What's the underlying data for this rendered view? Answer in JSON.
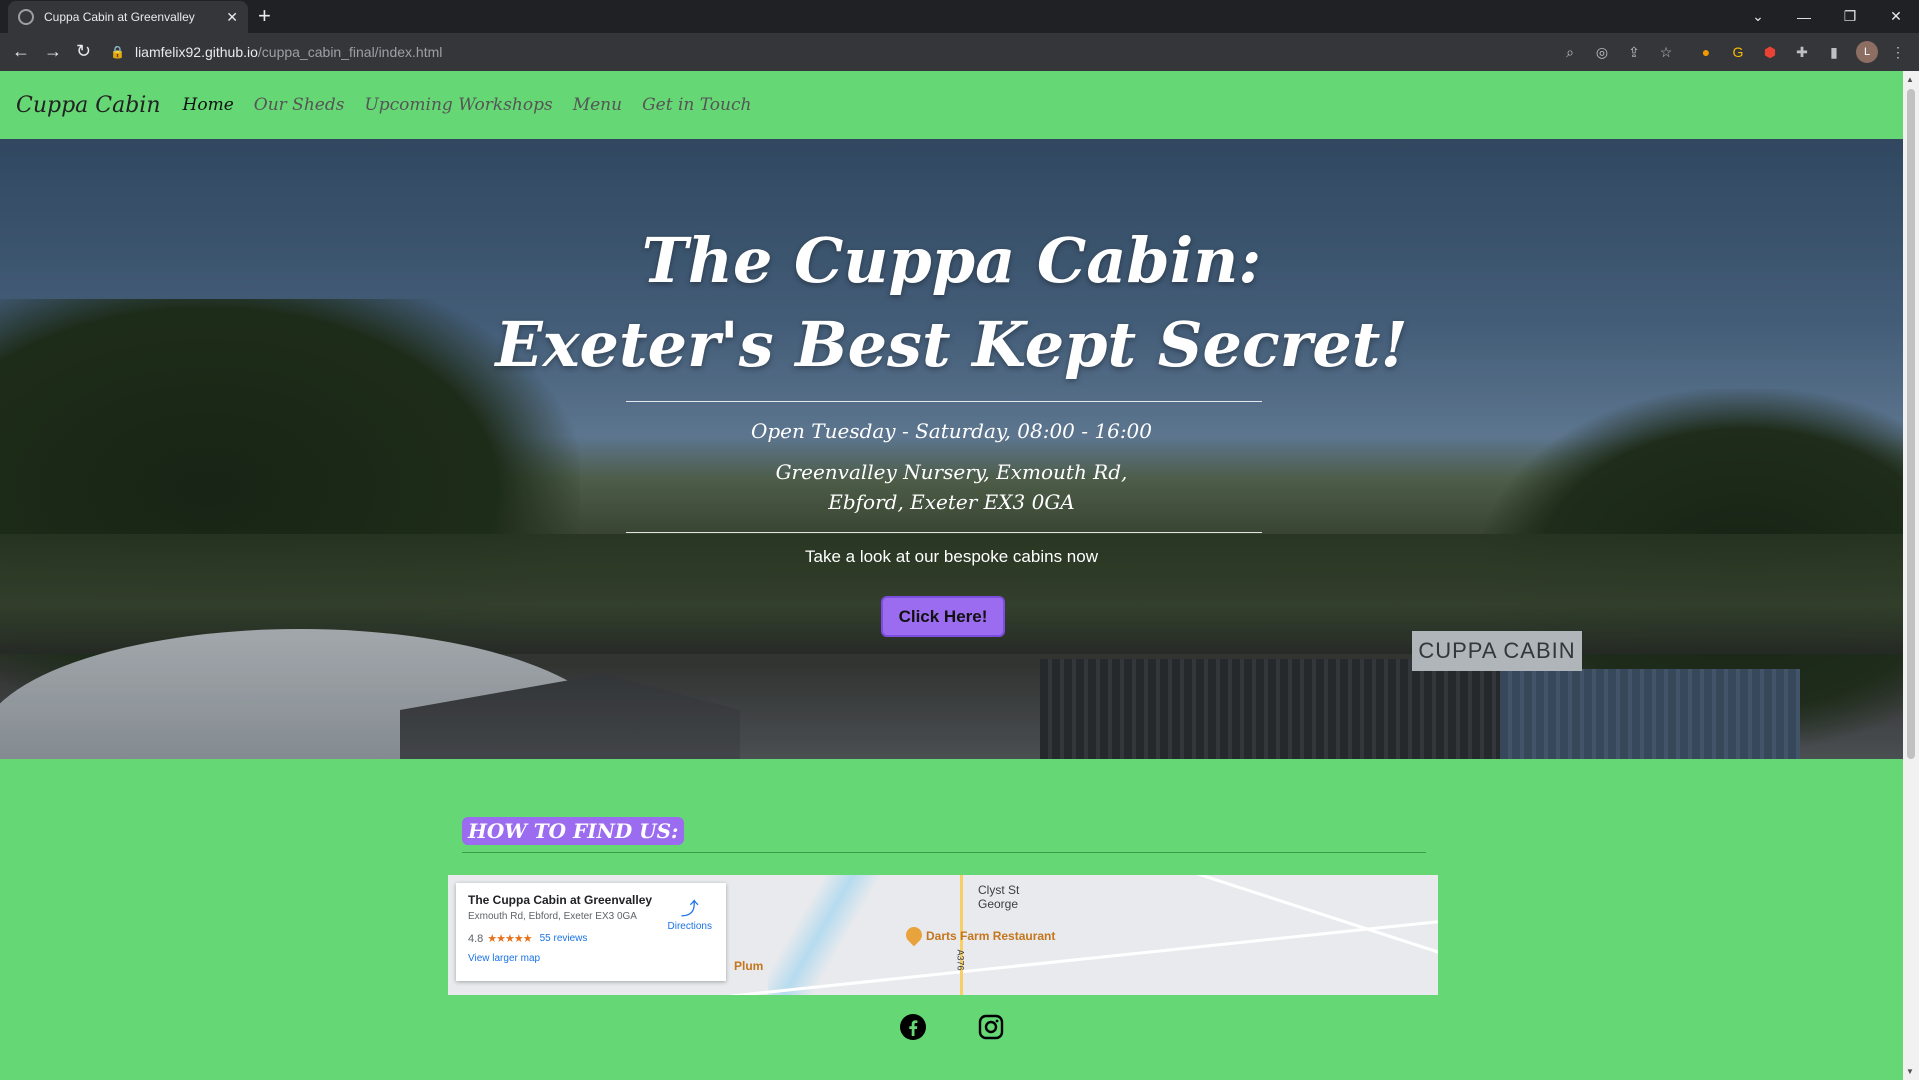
{
  "browser": {
    "tab_title": "Cuppa Cabin at Greenvalley",
    "url_host": "liamfelix92.github.io",
    "url_path": "/cuppa_cabin_final/index.html",
    "profile_initial": "L",
    "icons": [
      "back-icon",
      "forward-icon",
      "reload-icon",
      "lock-icon",
      "zoom-icon",
      "eye-off-icon",
      "share-icon",
      "star-icon",
      "extensions-icon",
      "side-panel-icon",
      "menu-icon"
    ]
  },
  "nav": {
    "brand": "Cuppa Cabin",
    "links": [
      "Home",
      "Our Sheds",
      "Upcoming Workshops",
      "Menu",
      "Get in Touch"
    ],
    "active": "Home"
  },
  "hero": {
    "title_line1": "The Cuppa Cabin:",
    "title_line2": "Exeter's Best Kept Secret!",
    "hours": "Open Tuesday - Saturday, 08:00 - 16:00",
    "address_line1": "Greenvalley Nursery, Exmouth Rd,",
    "address_line2": "Ebford, Exeter EX3 0GA",
    "tagline": "Take a look at our bespoke cabins now",
    "cta_label": "Click Here!",
    "sign_text": "CUPPA CABIN"
  },
  "find": {
    "heading": "HOW TO FIND US:"
  },
  "map": {
    "place_name": "The Cuppa Cabin at Greenvalley",
    "place_address": "Exmouth Rd, Ebford, Exeter EX3 0GA",
    "rating": "4.8",
    "stars": "★★★★★",
    "reviews": "55 reviews",
    "larger_map": "View larger map",
    "directions": "Directions",
    "label_town_1": "Clyst St",
    "label_town_2": "George",
    "poi_restaurant": "Darts Farm Restaurant",
    "poi_plum": "Plum",
    "road_label": "A376"
  },
  "colors": {
    "page_green": "#65d875",
    "accent_purple": "#9b6cf0"
  }
}
